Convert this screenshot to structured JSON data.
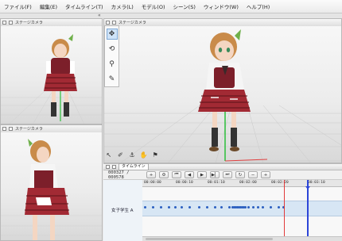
{
  "menu": [
    "ファイル(F)",
    "編集(E)",
    "タイムライン(T)",
    "カメラ(L)",
    "モデル(O)",
    "シーン(S)",
    "ウィンドウ(W)",
    "ヘルプ(H)"
  ],
  "panels": {
    "top_left_title": "ステージカメラ",
    "main_title": "ステージカメラ",
    "bottom_left_title": "ステージカメラ"
  },
  "timeline": {
    "tab_label": "タイムライン",
    "frame_counter": "000327 / 000578",
    "track_name": "女子学生 A",
    "ruler_labels": [
      "00:00:00",
      "00:00:10",
      "00:01:10",
      "00:02:00",
      "00:02:20",
      "00:03:10"
    ],
    "keyframes_count": 31
  },
  "colors": {
    "playhead": "#e23b3b",
    "end_marker": "#2c45d8",
    "track_band": "#d7e6f4",
    "keyframe": "#2b5fc0"
  }
}
